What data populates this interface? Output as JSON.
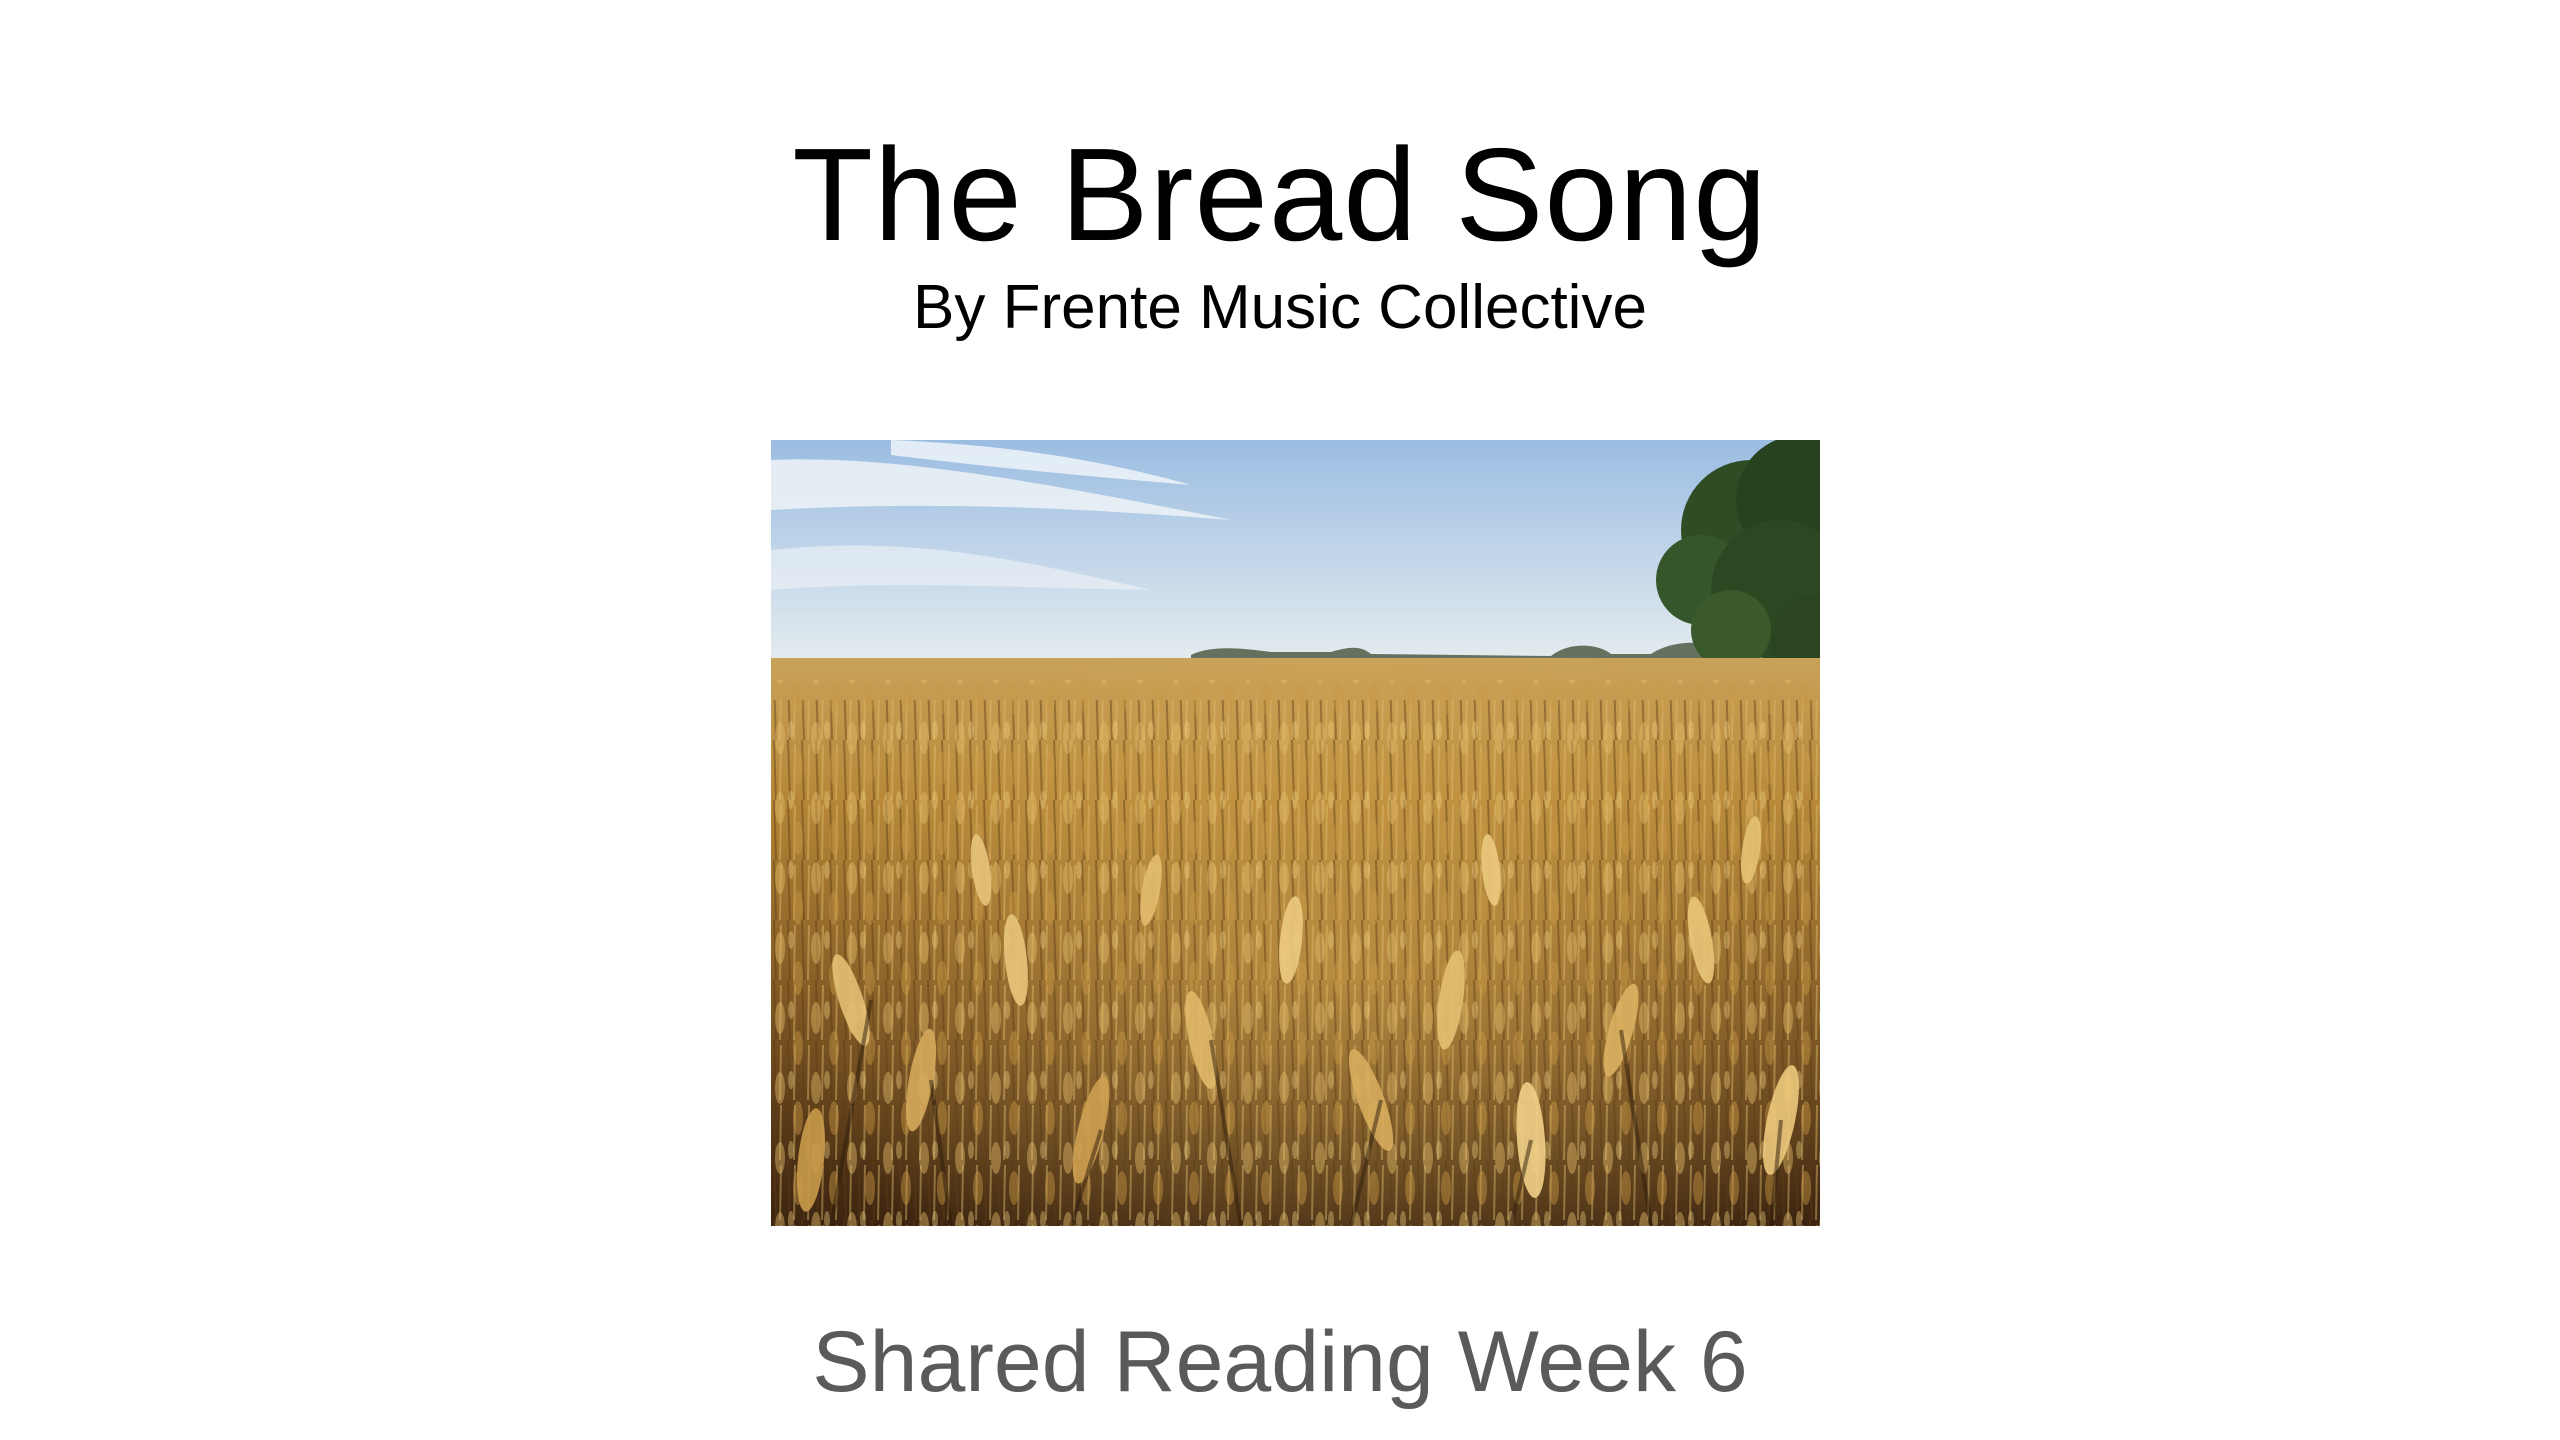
{
  "slide": {
    "title": "The Bread Song",
    "subtitle": "By Frente Music Collective",
    "footer": "Shared Reading Week 6"
  },
  "image": {
    "description_name": "wheat-field-photo"
  },
  "colors": {
    "title": "#000000",
    "footer": "#5a5a5a",
    "sky_top": "#9fc1e4",
    "sky_bottom": "#dfe8ee",
    "wheat_light": "#d7ad5c",
    "wheat_dark": "#3a2410",
    "tree": "#2d4a22"
  }
}
